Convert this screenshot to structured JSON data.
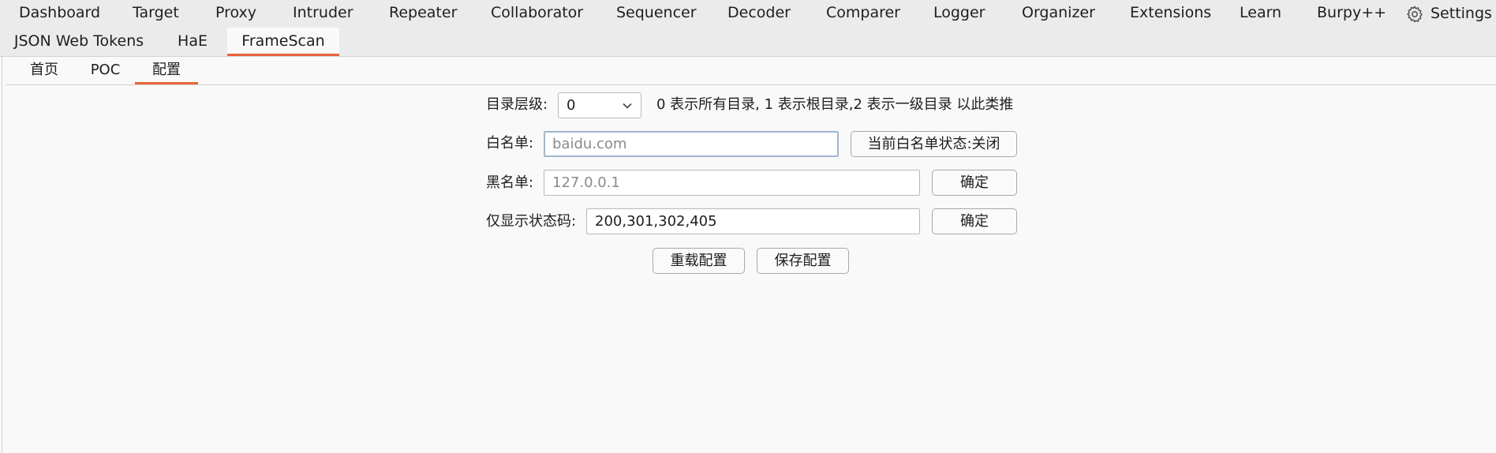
{
  "main_tabs": [
    "Dashboard",
    "Target",
    "Proxy",
    "Intruder",
    "Repeater",
    "Collaborator",
    "Sequencer",
    "Decoder",
    "Comparer",
    "Logger",
    "Organizer",
    "Extensions",
    "Learn",
    "Burpy++"
  ],
  "settings_label": "Settings",
  "ext_tabs": [
    "JSON Web Tokens",
    "HaE",
    "FrameScan"
  ],
  "active_ext_tab": "FrameScan",
  "sub_tabs": [
    "首页",
    "POC",
    "配置"
  ],
  "active_sub_tab": "配置",
  "form": {
    "depth_label": "目录层级:",
    "depth_value": "0",
    "depth_hint": "0 表示所有目录, 1 表示根目录,2 表示一级目录 以此类推",
    "whitelist_label": "白名单:",
    "whitelist_placeholder": "baidu.com",
    "whitelist_status_button": "当前白名单状态:关闭",
    "blacklist_label": "黑名单:",
    "blacklist_placeholder": "127.0.0.1",
    "blacklist_confirm": "确定",
    "status_label": "仅显示状态码:",
    "status_value": "200,301,302,405",
    "status_confirm": "确定",
    "reload_button": "重载配置",
    "save_button": "保存配置"
  },
  "colors": {
    "accent": "#e8643c",
    "tab_bar_bg": "#ebebeb",
    "panel_bg": "#f9f9f9"
  }
}
